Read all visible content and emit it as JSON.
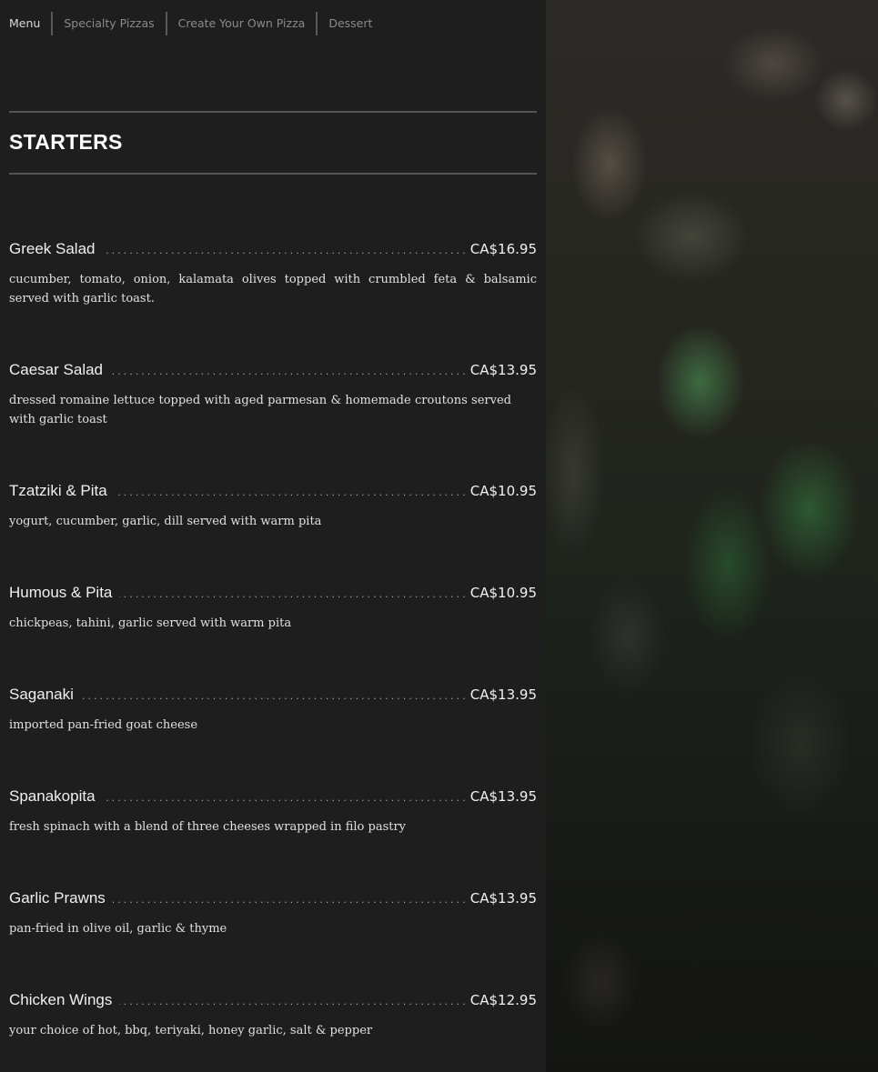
{
  "nav": {
    "items": [
      "Menu",
      "Specialty Pizzas",
      "Create Your Own Pizza",
      "Dessert"
    ]
  },
  "section": {
    "title": "STARTERS"
  },
  "items": [
    {
      "name": "Greek Salad",
      "price": "CA$16.95",
      "desc": "cucumber, tomato, onion, kalamata olives topped with crumbled feta & balsamic served with garlic toast."
    },
    {
      "name": "Caesar Salad",
      "price": "CA$13.95",
      "desc": "dressed romaine lettuce topped with aged parmesan & homemade croutons served with garlic toast"
    },
    {
      "name": "Tzatziki & Pita",
      "price": "CA$10.95",
      "desc": "yogurt, cucumber, garlic, dill served with warm pita"
    },
    {
      "name": "Humous & Pita",
      "price": "CA$10.95",
      "desc": "chickpeas, tahini, garlic served with warm pita"
    },
    {
      "name": "Saganaki",
      "price": "CA$13.95",
      "desc": "imported pan-fried goat cheese"
    },
    {
      "name": "Spanakopita",
      "price": "CA$13.95",
      "desc": "fresh spinach with a blend of three cheeses wrapped in filo pastry"
    },
    {
      "name": "Garlic Prawns",
      "price": "CA$13.95",
      "desc": "pan-fried in olive oil, garlic & thyme"
    },
    {
      "name": "Chicken Wings",
      "price": "CA$12.95",
      "desc": "your choice of hot, bbq, teriyaki, honey garlic, salt & pepper"
    }
  ]
}
